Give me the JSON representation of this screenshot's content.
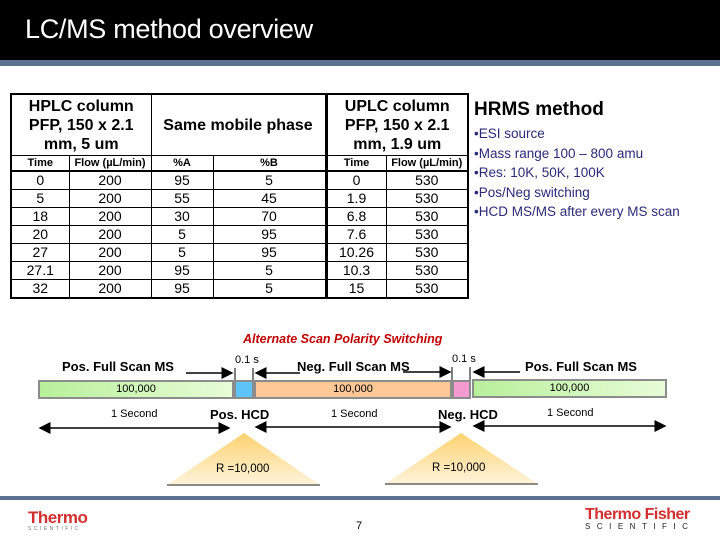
{
  "slide": {
    "title": "LC/MS method overview",
    "page_number": "7"
  },
  "table": {
    "headers": {
      "hplc": [
        "HPLC column",
        "PFP, 150 x 2.1",
        "mm, 5 um"
      ],
      "mobile": "Same mobile phase",
      "uplc": [
        "UPLC column",
        "PFP, 150 x 2.1",
        "mm, 1.9 um"
      ]
    },
    "subheaders": [
      "Time",
      "Flow (µL/min)",
      "%A",
      "%B",
      "Time",
      "Flow (µL/min)"
    ],
    "rows": [
      [
        "0",
        "200",
        "95",
        "5",
        "0",
        "530"
      ],
      [
        "5",
        "200",
        "55",
        "45",
        "1.9",
        "530"
      ],
      [
        "18",
        "200",
        "30",
        "70",
        "6.8",
        "530"
      ],
      [
        "20",
        "200",
        "5",
        "95",
        "7.6",
        "530"
      ],
      [
        "27",
        "200",
        "5",
        "95",
        "10.26",
        "530"
      ],
      [
        "27.1",
        "200",
        "95",
        "5",
        "10.3",
        "530"
      ],
      [
        "32",
        "200",
        "95",
        "5",
        "15",
        "530"
      ]
    ]
  },
  "hrms": {
    "heading": "HRMS method",
    "bullets": [
      "•ESI source",
      "•Mass range 100 – 800 amu",
      "•Res: 10K, 50K, 100K",
      "•Pos/Neg switching",
      "•HCD MS/MS after every MS scan"
    ]
  },
  "diagram": {
    "title": "Alternate Scan Polarity Switching",
    "scans": [
      {
        "label": "Pos. Full Scan MS",
        "resolution": "100,000",
        "duration": "1 Second",
        "color": "#b8f09a"
      },
      {
        "label": "Neg. Full Scan MS",
        "resolution": "100,000",
        "duration": "1 Second",
        "color": "#fdc896"
      },
      {
        "label": "Pos. Full Scan MS",
        "resolution": "100,000",
        "duration": "1 Second",
        "color": "#b8f09a"
      }
    ],
    "hcd": [
      {
        "label": "Pos. HCD",
        "interval": "0.1 s",
        "resolution": "R =10,000",
        "color": "#5cc4f8"
      },
      {
        "label": "Neg. HCD",
        "interval": "0.1 s",
        "resolution": "R =10,000",
        "color": "#f49ad0"
      }
    ]
  },
  "logos": {
    "left": {
      "name": "Thermo",
      "sub": "SCIENTIFIC"
    },
    "right": {
      "name": "Thermo Fisher",
      "sub": "SCIENTIFIC"
    }
  }
}
